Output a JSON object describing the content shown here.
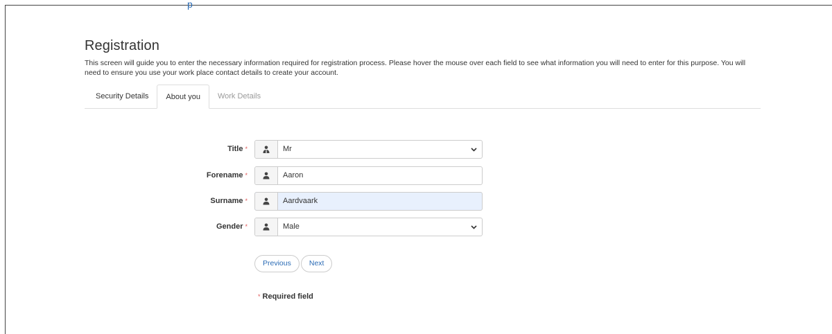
{
  "header": {
    "link_text": "p"
  },
  "page": {
    "title": "Registration",
    "intro": "This screen will guide you to enter the necessary information required for registration process. Please hover the mouse over each field to see what information you will need to enter for this purpose. You will need to ensure you use your work place contact details to create your account."
  },
  "tabs": [
    {
      "label": "Security Details",
      "state": "normal"
    },
    {
      "label": "About you",
      "state": "active"
    },
    {
      "label": "Work Details",
      "state": "disabled"
    }
  ],
  "form": {
    "required_marker": "*",
    "fields": [
      {
        "label": "Title",
        "value": "Mr",
        "type": "select",
        "icon": "user-tie-icon"
      },
      {
        "label": "Forename",
        "value": "Aaron",
        "type": "text",
        "icon": "user-icon"
      },
      {
        "label": "Surname",
        "value": "Aardvaark",
        "type": "text",
        "icon": "user-icon",
        "autofilled": true
      },
      {
        "label": "Gender",
        "value": "Male",
        "type": "select",
        "icon": "user-icon"
      }
    ],
    "previous_label": "Previous",
    "next_label": "Next",
    "required_note": "Required field"
  },
  "colors": {
    "link": "#2a6bb5",
    "required_star": "#e05a5a",
    "autofill_bg": "#e8f0fd",
    "border": "#cccccc"
  }
}
